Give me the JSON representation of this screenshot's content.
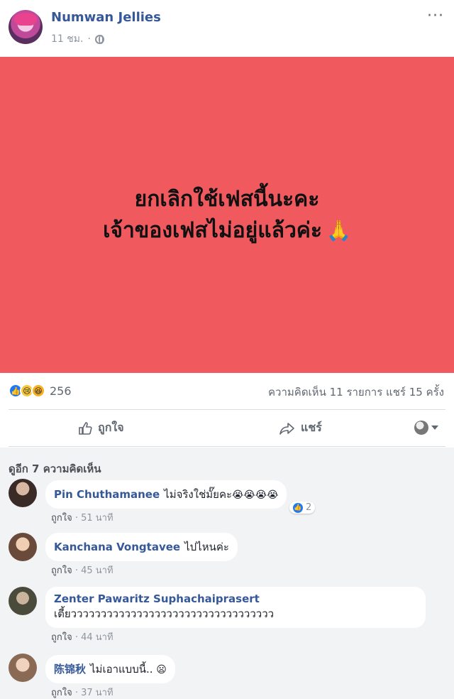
{
  "post": {
    "author": "Numwan Jellies",
    "time": "11 ชม.",
    "more_label": "···",
    "line1": "ยกเลิกใช้เฟสนี้นะคะ",
    "line2": "เจ้าของเฟสไม่อยู่แล้วค่ะ",
    "line2_emoji": "🙏",
    "bg_color": "#f0595e"
  },
  "stats": {
    "reaction_count": "256",
    "reaction_icons": [
      "like-icon",
      "sad-icon",
      "haha-icon"
    ],
    "comments_shares": "ความคิดเห็น 11 รายการ  แชร์ 15 ครั้ง"
  },
  "actions": {
    "like_label": "ถูกใจ",
    "share_label": "แชร์"
  },
  "comments": {
    "view_more": "ดูอีก 7 ความคิดเห็น",
    "items": [
      {
        "name": "Pin Chuthamanee",
        "text": "ไม่จริงใช่มั๊ยคะ",
        "emoji": "😭😭😭😭",
        "like": "ถูกใจ",
        "time": "51 นาที",
        "reaction_count": "2"
      },
      {
        "name": "Kanchana Vongtavee",
        "text": "ไปไหนค่ะ",
        "emoji": "",
        "like": "ถูกใจ",
        "time": "45 นาที"
      },
      {
        "name": "Zenter Pawaritz Suphachaiprasert",
        "text": "เตี้ยวววววววววววววววววววววววววววววววววว",
        "emoji": "",
        "like": "ถูกใจ",
        "time": "44 นาที"
      },
      {
        "name": "陈锦秋",
        "text": "ไม่เอาแบบนี้..",
        "emoji": "😦",
        "like": "ถูกใจ",
        "time": "37 นาที"
      }
    ]
  }
}
